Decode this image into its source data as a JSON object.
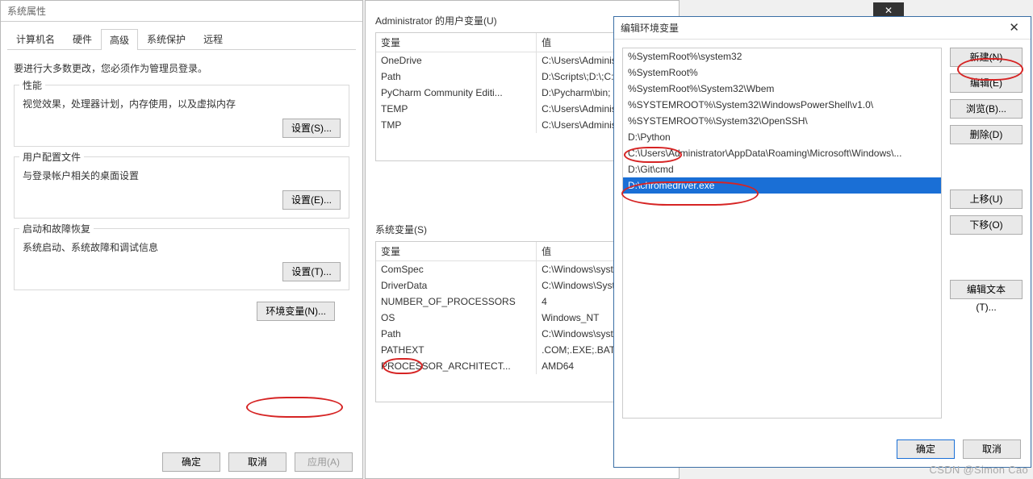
{
  "sysprops": {
    "title": "系统属性",
    "tabs": [
      "计算机名",
      "硬件",
      "高级",
      "系统保护",
      "远程"
    ],
    "active_tab": 2,
    "note": "要进行大多数更改，您必须作为管理员登录。",
    "groups": [
      {
        "title": "性能",
        "desc": "视觉效果，处理器计划，内存使用，以及虚拟内存",
        "btn": "设置(S)..."
      },
      {
        "title": "用户配置文件",
        "desc": "与登录帐户相关的桌面设置",
        "btn": "设置(E)..."
      },
      {
        "title": "启动和故障恢复",
        "desc": "系统启动、系统故障和调试信息",
        "btn": "设置(T)..."
      }
    ],
    "env_btn": "环境变量(N)...",
    "ok": "确定",
    "cancel": "取消",
    "apply": "应用(A)"
  },
  "envwin": {
    "user_label": "Administrator 的用户变量(U)",
    "sys_label": "系统变量(S)",
    "th_var": "变量",
    "th_val": "值",
    "user_vars": [
      {
        "var": "OneDrive",
        "val": "C:\\Users\\Administrat"
      },
      {
        "var": "Path",
        "val": "D:\\Scripts\\;D:\\;C:\\U"
      },
      {
        "var": "PyCharm Community Editi...",
        "val": "D:\\Pycharm\\bin;"
      },
      {
        "var": "TEMP",
        "val": "C:\\Users\\Administrat"
      },
      {
        "var": "TMP",
        "val": "C:\\Users\\Administrat"
      }
    ],
    "sys_vars": [
      {
        "var": "ComSpec",
        "val": "C:\\Windows\\system"
      },
      {
        "var": "DriverData",
        "val": "C:\\Windows\\System"
      },
      {
        "var": "NUMBER_OF_PROCESSORS",
        "val": "4"
      },
      {
        "var": "OS",
        "val": "Windows_NT"
      },
      {
        "var": "Path",
        "val": "C:\\Windows\\system"
      },
      {
        "var": "PATHEXT",
        "val": ".COM;.EXE;.BAT;.C"
      },
      {
        "var": "PROCESSOR_ARCHITECT...",
        "val": "AMD64"
      }
    ]
  },
  "editwin": {
    "title": "编辑环境变量",
    "paths": [
      "%SystemRoot%\\system32",
      "%SystemRoot%",
      "%SystemRoot%\\System32\\Wbem",
      "%SYSTEMROOT%\\System32\\WindowsPowerShell\\v1.0\\",
      "%SYSTEMROOT%\\System32\\OpenSSH\\",
      "D:\\Python",
      "C:\\Users\\Administrator\\AppData\\Roaming\\Microsoft\\Windows\\...",
      "D:\\Git\\cmd",
      "D:\\chromedriver.exe"
    ],
    "selected_index": 8,
    "btns": {
      "new": "新建(N)",
      "edit": "编辑(E)",
      "browse": "浏览(B)...",
      "delete": "删除(D)",
      "up": "上移(U)",
      "down": "下移(O)",
      "edit_text": "编辑文本(T)..."
    },
    "ok": "确定",
    "cancel": "取消"
  },
  "watermark": "CSDN @Simon Cao"
}
